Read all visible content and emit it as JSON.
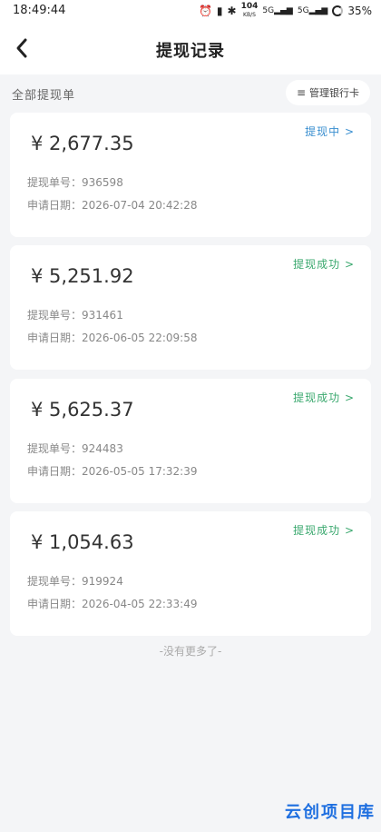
{
  "statusbar": {
    "time": "18:49:44",
    "network_speed": "104",
    "speed_unit": "KB/S",
    "signal_1": "5G",
    "signal_2": "5G",
    "battery": "35%"
  },
  "header": {
    "title": "提现记录"
  },
  "subbar": {
    "label": "全部提现单",
    "manage_button": "管理银行卡"
  },
  "records": [
    {
      "amount": "¥ 2,677.35",
      "status": "提现中 >",
      "status_type": "processing",
      "order_label": "提现单号：",
      "order_no": "936598",
      "date_label": "申请日期：",
      "date": "2026-07-04 20:42:28"
    },
    {
      "amount": "¥ 5,251.92",
      "status": "提现成功 >",
      "status_type": "success",
      "order_label": "提现单号：",
      "order_no": "931461",
      "date_label": "申请日期：",
      "date": "2026-06-05 22:09:58"
    },
    {
      "amount": "¥ 5,625.37",
      "status": "提现成功 >",
      "status_type": "success",
      "order_label": "提现单号：",
      "order_no": "924483",
      "date_label": "申请日期：",
      "date": "2026-05-05 17:32:39"
    },
    {
      "amount": "¥ 1,054.63",
      "status": "提现成功 >",
      "status_type": "success",
      "order_label": "提现单号：",
      "order_no": "919924",
      "date_label": "申请日期：",
      "date": "2026-04-05 22:33:49"
    }
  ],
  "footer": {
    "no_more": "-没有更多了-"
  },
  "watermark": "云创项目库",
  "colors": {
    "processing": "#3a8fd0",
    "success": "#3aa86e",
    "background": "#f4f5f7"
  }
}
